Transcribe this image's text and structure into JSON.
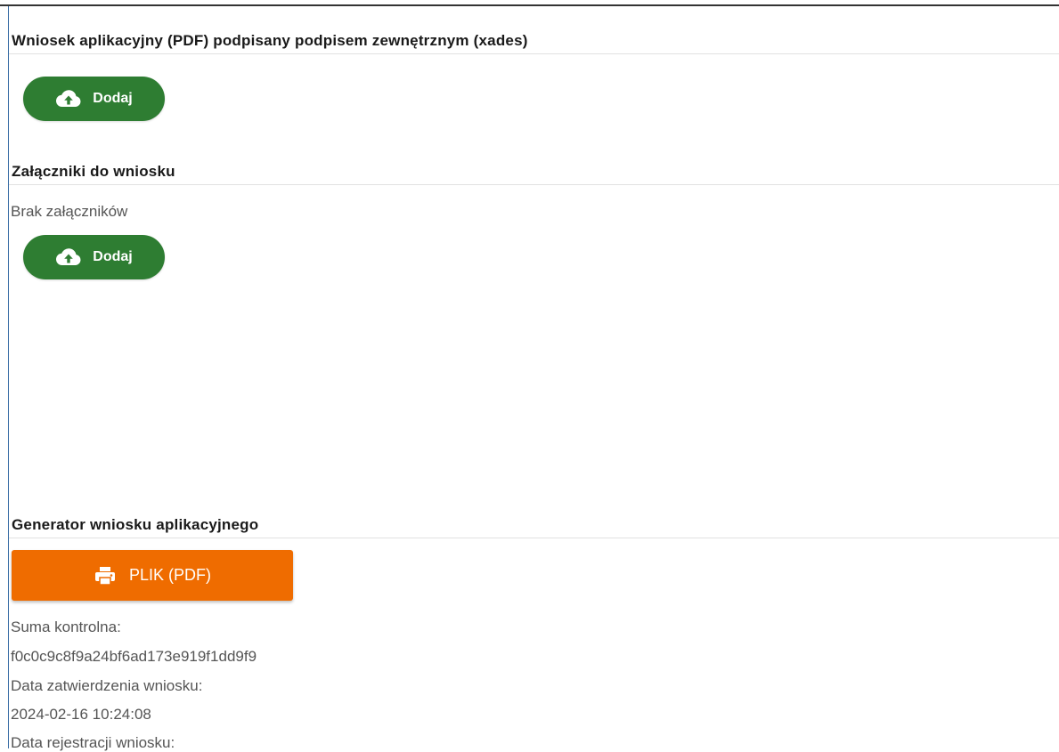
{
  "sections": {
    "signed_application": {
      "title": "Wniosek aplikacyjny (PDF) podpisany podpisem zewnętrznym (xades)",
      "add_button": {
        "label": "Dodaj",
        "icon": "cloud-upload-icon"
      }
    },
    "attachments": {
      "title": "Załączniki do wniosku",
      "empty_text": "Brak załączników",
      "add_button": {
        "label": "Dodaj",
        "icon": "cloud-upload-icon"
      }
    },
    "generator": {
      "title": "Generator wniosku aplikacyjnego",
      "file_button": {
        "label": "PLIK (PDF)",
        "icon": "printer-icon"
      },
      "checksum_label": "Suma kontrolna:",
      "checksum_value": "f0c0c9c8f9a24bf6ad173e919f1dd9f9",
      "approval_date_label": "Data zatwierdzenia wniosku:",
      "approval_date_value": "2024-02-16 10:24:08",
      "registration_date_label": "Data rejestracji wniosku:"
    }
  },
  "colors": {
    "add_button": "#2e7d32",
    "file_button": "#ef6c00",
    "frame_border": "#3a6ea5"
  }
}
